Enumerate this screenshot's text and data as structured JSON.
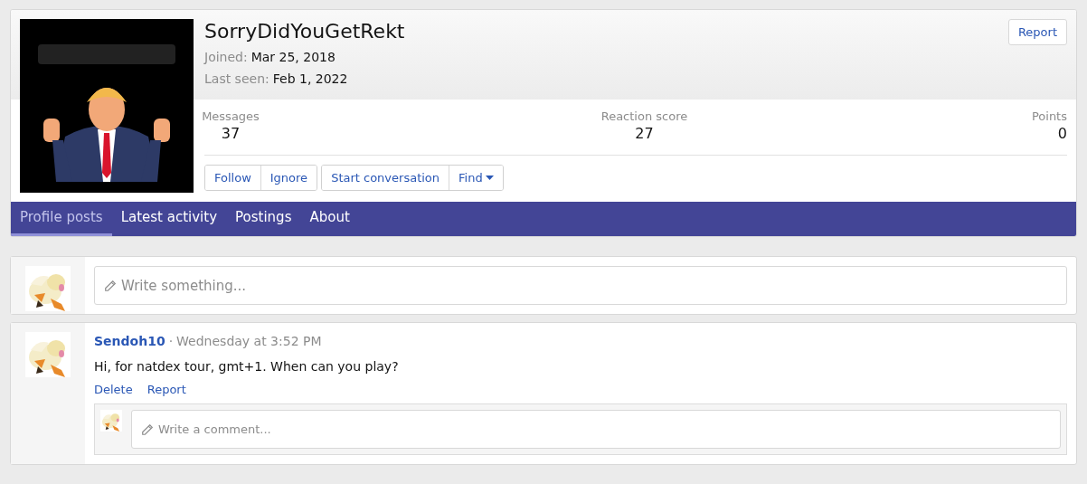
{
  "profile": {
    "avatar": {
      "kind": "picture"
    },
    "username": "SorryDidYouGetRekt",
    "facts": [
      {
        "label": "Joined:",
        "value": "Mar 25, 2018"
      },
      {
        "label": "Last seen:",
        "value": "Feb 1, 2022"
      }
    ],
    "report_button": "Report",
    "stats": [
      {
        "label": "Messages",
        "value": "37"
      },
      {
        "label": "Reaction score",
        "value": "27"
      },
      {
        "label": "Points",
        "value": "0"
      }
    ],
    "button_groups": [
      [
        "Follow",
        "Ignore"
      ],
      [
        "Start conversation",
        "Find"
      ]
    ],
    "tabs": [
      {
        "label": "Profile posts",
        "selected": true
      },
      {
        "label": "Latest activity",
        "selected": false
      },
      {
        "label": "Postings",
        "selected": false
      },
      {
        "label": "About",
        "selected": false
      }
    ]
  },
  "composer": {
    "placeholder": "Write something..."
  },
  "posts": [
    {
      "author": "Sendoh10",
      "separator": "·",
      "time": "Wednesday at 3:52 PM",
      "text": "Hi, for natdex tour, gmt+1. When can you play?",
      "actions": [
        "Delete",
        "Report"
      ],
      "comment_placeholder": "Write a comment..."
    }
  ]
}
